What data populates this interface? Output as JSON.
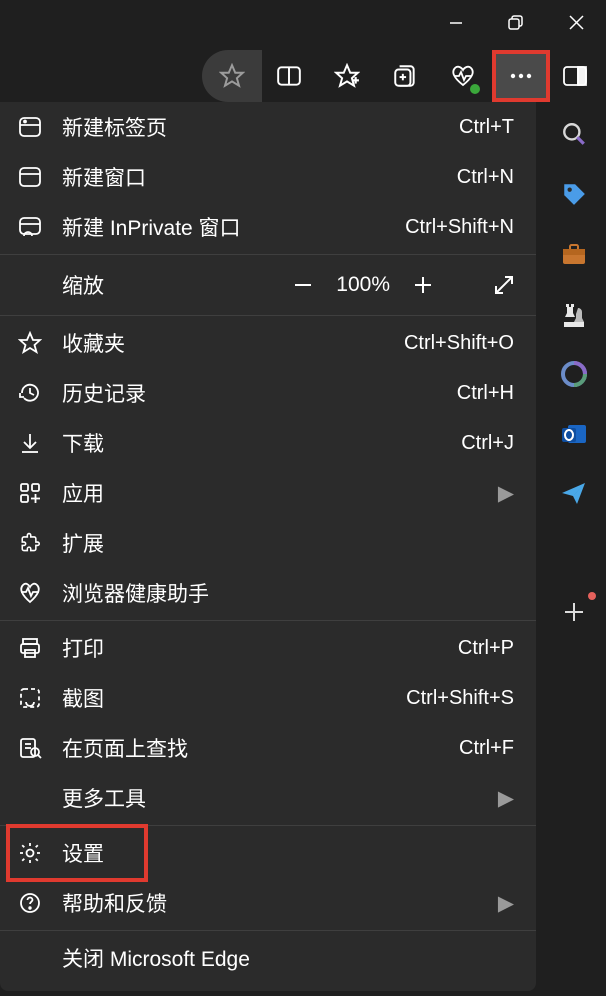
{
  "window": {
    "minimize": "–",
    "maximize": "❐",
    "close": "✕"
  },
  "menu": {
    "new_tab": {
      "label": "新建标签页",
      "shortcut": "Ctrl+T"
    },
    "new_window": {
      "label": "新建窗口",
      "shortcut": "Ctrl+N"
    },
    "new_inprivate": {
      "label": "新建 InPrivate 窗口",
      "shortcut": "Ctrl+Shift+N"
    },
    "zoom": {
      "label": "缩放",
      "value": "100%"
    },
    "favorites": {
      "label": "收藏夹",
      "shortcut": "Ctrl+Shift+O"
    },
    "history": {
      "label": "历史记录",
      "shortcut": "Ctrl+H"
    },
    "downloads": {
      "label": "下载",
      "shortcut": "Ctrl+J"
    },
    "apps": {
      "label": "应用"
    },
    "extensions": {
      "label": "扩展"
    },
    "health": {
      "label": "浏览器健康助手"
    },
    "print": {
      "label": "打印",
      "shortcut": "Ctrl+P"
    },
    "screenshot": {
      "label": "截图",
      "shortcut": "Ctrl+Shift+S"
    },
    "find": {
      "label": "在页面上查找",
      "shortcut": "Ctrl+F"
    },
    "more_tools": {
      "label": "更多工具"
    },
    "settings": {
      "label": "设置"
    },
    "help": {
      "label": "帮助和反馈"
    },
    "close_edge": {
      "label": "关闭 Microsoft Edge"
    }
  }
}
